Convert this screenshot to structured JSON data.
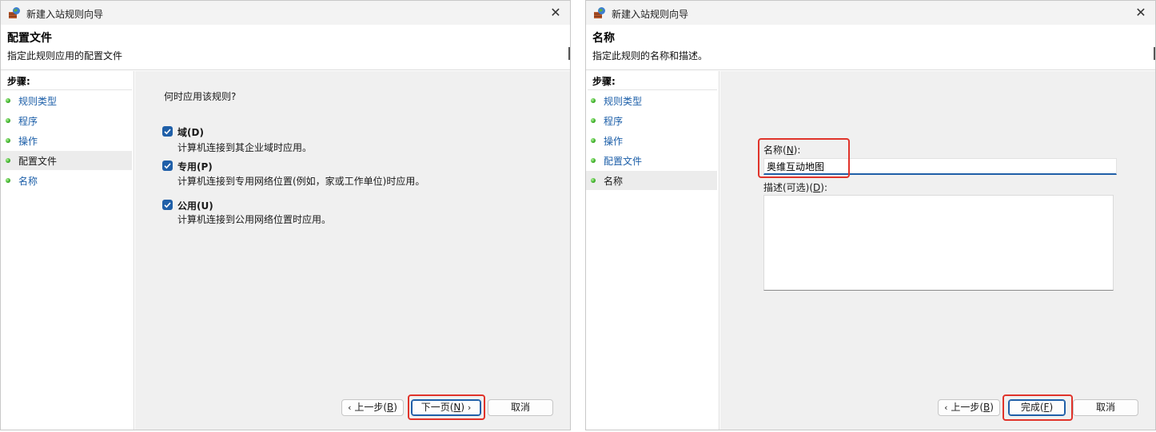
{
  "colors": {
    "accent": "#1f5fa8",
    "highlight": "#e0332a",
    "step_dot": "#3fb52b"
  },
  "left_window": {
    "title": "新建入站规则向导",
    "header": {
      "title": "配置文件",
      "subtitle": "指定此规则应用的配置文件"
    },
    "steps_title": "步骤:",
    "steps": [
      {
        "label": "规则类型",
        "current": false
      },
      {
        "label": "程序",
        "current": false
      },
      {
        "label": "操作",
        "current": false
      },
      {
        "label": "配置文件",
        "current": true
      },
      {
        "label": "名称",
        "current": false
      }
    ],
    "question": "何时应用该规则?",
    "options": [
      {
        "label": "域(D)",
        "description": "计算机连接到其企业域时应用。",
        "checked": true
      },
      {
        "label": "专用(P)",
        "description": "计算机连接到专用网络位置(例如，家或工作单位)时应用。",
        "checked": true
      },
      {
        "label": "公用(U)",
        "description": "计算机连接到公用网络位置时应用。",
        "checked": true
      }
    ],
    "buttons": {
      "back": {
        "icon": "chevron-left-icon",
        "text": "上一步(",
        "key": "B",
        "end": ")"
      },
      "next": {
        "text": "下一页(",
        "key": "N",
        "end": ")",
        "icon": "chevron-right-icon"
      },
      "cancel": "取消"
    }
  },
  "right_window": {
    "title": "新建入站规则向导",
    "header": {
      "title": "名称",
      "subtitle": "指定此规则的名称和描述。"
    },
    "steps_title": "步骤:",
    "steps": [
      {
        "label": "规则类型",
        "current": false
      },
      {
        "label": "程序",
        "current": false
      },
      {
        "label": "操作",
        "current": false
      },
      {
        "label": "配置文件",
        "current": false
      },
      {
        "label": "名称",
        "current": true
      }
    ],
    "name_label": {
      "text": "名称(",
      "key": "N",
      "end": "):"
    },
    "name_value": "奥维互动地图",
    "desc_label": {
      "text": "描述(可选)(",
      "key": "D",
      "end": "):"
    },
    "desc_value": "",
    "buttons": {
      "back": {
        "icon": "chevron-left-icon",
        "text": "上一步(",
        "key": "B",
        "end": ")"
      },
      "finish": {
        "text": "完成(",
        "key": "F",
        "end": ")"
      },
      "cancel": "取消"
    }
  }
}
